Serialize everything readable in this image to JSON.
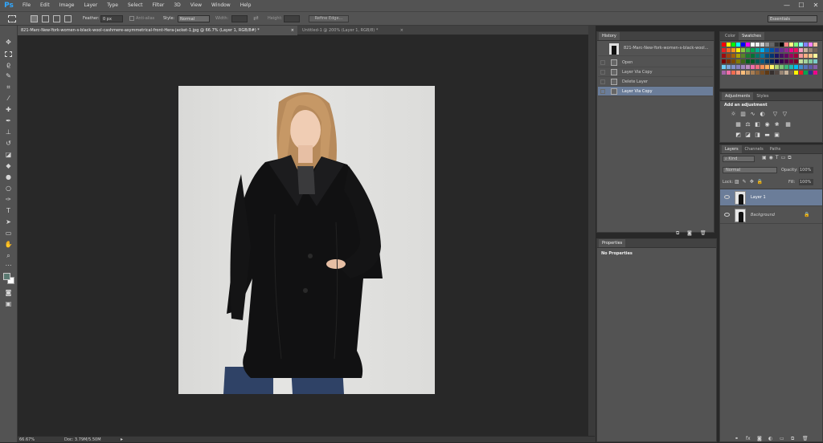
{
  "app": {
    "logo": "Ps"
  },
  "menu": [
    "File",
    "Edit",
    "Image",
    "Layer",
    "Type",
    "Select",
    "Filter",
    "3D",
    "View",
    "Window",
    "Help"
  ],
  "window_controls": [
    "—",
    "☐",
    "✕"
  ],
  "options": {
    "feather_label": "Feather:",
    "feather_value": "0 px",
    "antialias_label": "Anti-alias",
    "style_label": "Style:",
    "style_value": "Normal",
    "width_label": "Width:",
    "height_label": "Height:",
    "refine_edge": "Refine Edge...",
    "workspace": "Essentials"
  },
  "tabs": [
    {
      "label": "821-Marc-New-York-women-s-black-wool-cashmere-asymmetrical-front-Hera-jacket-1.jpg @ 66.7% (Layer 1, RGB/8#) *",
      "close": "×"
    },
    {
      "label": "Untitled-1 @ 200% (Layer 1, RGB/8) *",
      "close": "×"
    }
  ],
  "status": {
    "zoom": "66.67%",
    "doc": "Doc: 3.79M/5.50M"
  },
  "history": {
    "title": "History",
    "snapshot": "821-Marc-New-York-women-s-black-wool...",
    "items": [
      "Open",
      "Layer Via Copy",
      "Delete Layer",
      "Layer Via Copy"
    ],
    "selected_index": 3
  },
  "properties": {
    "title": "Properties",
    "content": "No Properties"
  },
  "color_panel": {
    "tabs": [
      "Color",
      "Swatches"
    ],
    "active": "Swatches"
  },
  "adjustments": {
    "tabs": [
      "Adjustments",
      "Styles"
    ],
    "heading": "Add an adjustment"
  },
  "layers_panel": {
    "tabs": [
      "Layers",
      "Channels",
      "Paths"
    ],
    "kind": "Kind",
    "blend_mode": "Normal",
    "opacity_label": "Opacity:",
    "opacity": "100%",
    "lock_label": "Lock:",
    "fill_label": "Fill:",
    "fill": "100%",
    "layers": [
      {
        "name": "Layer 1",
        "selected": true,
        "locked": false
      },
      {
        "name": "Background",
        "selected": false,
        "locked": true
      }
    ]
  },
  "colors": {
    "selection": "#6b7d99",
    "foreground": "#5b7a72",
    "background": "#ffffff",
    "swatch_rows": [
      [
        "#ff0000",
        "#ffff00",
        "#00ff00",
        "#00ffff",
        "#0000ff",
        "#ff00ff",
        "#ffffff",
        "#eeeeee",
        "#cccccc",
        "#999999",
        "#666666",
        "#333333",
        "#000000",
        "#ff8080",
        "#ffff80",
        "#80ff80",
        "#80ffff",
        "#8080ff",
        "#ff80ff",
        "#f0c0a0"
      ],
      [
        "#ed1c24",
        "#f26522",
        "#f7941d",
        "#fff200",
        "#8dc63f",
        "#39b54a",
        "#00a651",
        "#00a99d",
        "#00aeef",
        "#0072bc",
        "#0054a6",
        "#2e3192",
        "#662d91",
        "#92278f",
        "#ec008c",
        "#ed145b",
        "#f49ac1",
        "#c7b299",
        "#998675",
        "#736357"
      ],
      [
        "#9e0b0f",
        "#a0410d",
        "#a36209",
        "#aba000",
        "#598527",
        "#1a7b30",
        "#007236",
        "#00746b",
        "#0076a3",
        "#004a80",
        "#003471",
        "#1b1464",
        "#440e62",
        "#630460",
        "#9e005d",
        "#9e0039",
        "#f5989d",
        "#f9ad81",
        "#fdc68a",
        "#fff79a"
      ],
      [
        "#790000",
        "#7b2e00",
        "#7d4900",
        "#827b00",
        "#406618",
        "#005e20",
        "#005826",
        "#005952",
        "#005b7f",
        "#003663",
        "#002157",
        "#0d004c",
        "#32004b",
        "#4b0049",
        "#7b0046",
        "#7a0026",
        "#c4df9b",
        "#a3d39c",
        "#82ca9c",
        "#7accc8"
      ],
      [
        "#6dcff6",
        "#7da7d9",
        "#8393ca",
        "#8781bd",
        "#a187be",
        "#bd8cbf",
        "#f06eaa",
        "#f26d7d",
        "#f68e56",
        "#fbaf5d",
        "#fff568",
        "#acd373",
        "#7cc576",
        "#3cb878",
        "#1cbbb4",
        "#00bff3",
        "#448ccb",
        "#5674b9",
        "#605ca8",
        "#855fa8"
      ],
      [
        "#a864a8",
        "#f06ea9",
        "#f26c4f",
        "#f7977a",
        "#fdbd7a",
        "#c69c6d",
        "#a67c52",
        "#8c6239",
        "#754c24",
        "#603913",
        "#362f2d",
        "#534741",
        "#998675",
        "#c7b299",
        "#736357",
        "#fff200",
        "#ed1c24",
        "#00a651",
        "#2e3192",
        "#ec008c"
      ]
    ]
  }
}
